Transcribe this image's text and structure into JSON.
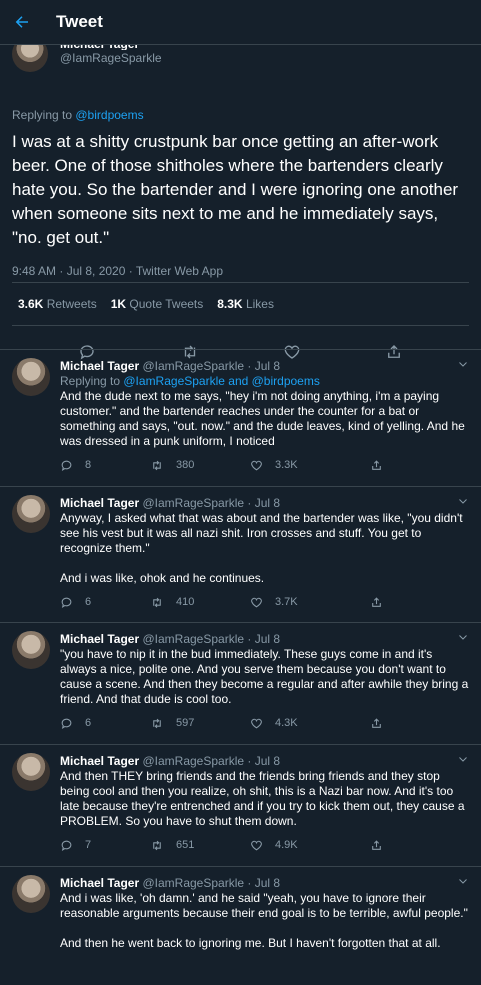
{
  "header": {
    "title": "Tweet"
  },
  "main_tweet": {
    "author_name": "Michael Tager",
    "author_handle": "@IamRageSparkle",
    "replying_prefix": "Replying to ",
    "replying_to": "@birdpoems",
    "text": "I was at a shitty crustpunk bar once getting an after-work beer. One of those shitholes where the bartenders clearly hate you. So the bartender and I were ignoring one another when someone sits next to me and he immediately says, \"no. get out.\"",
    "time": "9:48 AM · Jul 8, 2020 · Twitter Web App",
    "retweets_count": "3.6K",
    "retweets_label": "Retweets",
    "quotes_count": "1K",
    "quotes_label": "Quote Tweets",
    "likes_count": "8.3K",
    "likes_label": "Likes"
  },
  "replies": [
    {
      "name": "Michael Tager",
      "handle": "@IamRageSparkle",
      "date": "· Jul 8",
      "replying_prefix": "Replying to ",
      "replying_to": "@IamRageSparkle and @birdpoems",
      "text": "And the dude next to me says, \"hey i'm not doing anything, i'm a paying customer.\" and the bartender reaches under the counter for a bat or something and says, \"out. now.\" and the dude leaves, kind of yelling. And he was dressed in a punk uniform, I noticed",
      "replies": "8",
      "retweets": "380",
      "likes": "3.3K"
    },
    {
      "name": "Michael Tager",
      "handle": "@IamRageSparkle",
      "date": "· Jul 8",
      "text": "Anyway, I asked what that was about and the bartender was like, \"you didn't see his vest but it was all nazi shit. Iron crosses and stuff. You get to recognize them.\"\n\nAnd i was like, ohok and he continues.",
      "replies": "6",
      "retweets": "410",
      "likes": "3.7K"
    },
    {
      "name": "Michael Tager",
      "handle": "@IamRageSparkle",
      "date": "· Jul 8",
      "text": "\"you have to nip it in the bud immediately. These guys come in and it's always a nice, polite one. And you serve them because you don't want to cause a scene. And then they become a regular and after awhile they bring a friend. And that dude is cool too.",
      "replies": "6",
      "retweets": "597",
      "likes": "4.3K"
    },
    {
      "name": "Michael Tager",
      "handle": "@IamRageSparkle",
      "date": "· Jul 8",
      "text": "And then THEY bring friends and the friends bring friends and they stop being cool and then you realize, oh shit, this is a Nazi bar now. And it's too late because they're entrenched and if you try to kick them out, they cause a PROBLEM. So you have to shut them down.",
      "replies": "7",
      "retweets": "651",
      "likes": "4.9K"
    },
    {
      "name": "Michael Tager",
      "handle": "@IamRageSparkle",
      "date": "· Jul 8",
      "text": "And i was like, 'oh damn.' and he said \"yeah, you have to ignore their reasonable arguments because their end goal is to be terrible, awful people.\"\n\nAnd then he went back to ignoring me. But I haven't forgotten that at all."
    }
  ]
}
